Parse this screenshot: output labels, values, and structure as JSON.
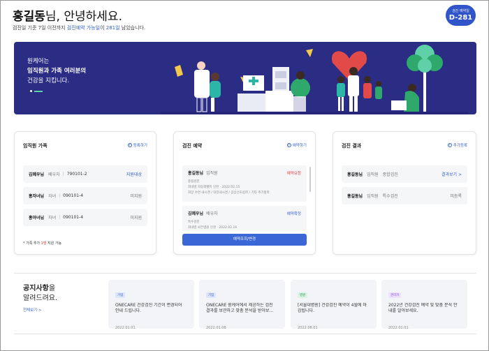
{
  "header": {
    "name": "홍길동",
    "greeting_suffix": "님, 안녕하세요.",
    "sub_prefix": "검진일 기준 7일 이전까지 ",
    "sub_link": "검진예약 가능일",
    "sub_mid": "이 ",
    "sub_days": "281일",
    "sub_suffix": " 남았습니다.",
    "dday_label": "검진 예약일",
    "dday_value": "D-281"
  },
  "banner": {
    "line1": "원케어는",
    "line2": "임직원과 가족 여러분의",
    "line3": "건강을 지킵니다."
  },
  "family": {
    "title": "임직원 가족",
    "action": "등록하기",
    "rows": [
      {
        "name": "김혜우님",
        "relation": "배우자",
        "birth": "790101-2",
        "status": "지원대상",
        "status_color": "#2f5fd0"
      },
      {
        "name": "홍자녀님",
        "relation": "자녀",
        "birth": "090101-4",
        "status": "미지원",
        "status_color": "#777777"
      },
      {
        "name": "홍아녀님",
        "relation": "자녀",
        "birth": "090101-4",
        "status": "미지원",
        "status_color": "#777777"
      }
    ],
    "note_prefix": "* 가족 추가 ",
    "note_count": "1명",
    "note_suffix": " 지원 가능"
  },
  "reservation": {
    "title": "검진 예약",
    "action": "예약하기",
    "items": [
      {
        "name": "홍길동님",
        "relation": "임직원",
        "status": "예약요청",
        "status_color": "#e23c3c",
        "line1": "종합검진",
        "line2": "희내병 자동레벨지 인천 · 2022.02.15",
        "line3": "희망 수면 내시경 / 대장내시경 / 갑상선초음파 / 기타 추가항목"
      },
      {
        "name": "김혜우님",
        "relation": "배우자",
        "status": "예약확정",
        "status_color": "#2f5fd0",
        "line1": "특수검진",
        "line2": "희내병 보은병원 인천 · 2022.02.16",
        "line3": ""
      }
    ],
    "button": "예약조회/변경"
  },
  "results": {
    "title": "검진 결과",
    "action": "추가등록",
    "rows": [
      {
        "name": "홍길동님",
        "relation": "임직원",
        "type": "종합검진",
        "status": "결과보기 >",
        "status_color": "#2f5fd0"
      },
      {
        "name": "홍길동님",
        "relation": "임직원",
        "type": "특수검진",
        "status": "미등록",
        "status_color": "#777777"
      }
    ]
  },
  "notice": {
    "title_bold": "공지사항",
    "title_rest1": "을",
    "title_rest2": "알려드려요.",
    "all_link": "전체보기 >",
    "cards": [
      {
        "tag": "기업",
        "tag_class": "t-blue",
        "text": "ONECARE 건강검진 기간이 변경되어 안내 드립니다.",
        "date": "2022.01.01"
      },
      {
        "tag": "기업",
        "tag_class": "t-blue",
        "text": "ONECARE 원케어에서 제공하는 검진 결과를 보관하고 맞춤 분석을 받아보...",
        "date": "2022.01.08"
      },
      {
        "tag": "병원",
        "tag_class": "t-green",
        "text": "[서울대병원] 건강검진 예약이 4월에 마감됩니다.",
        "date": "2022.08.01"
      },
      {
        "tag": "관리자",
        "tag_class": "t-purple",
        "text": "2022년 건강검진 예약 및 맞춤 분석 안내를 알아보세요.",
        "date": "2022.01.01"
      }
    ]
  }
}
